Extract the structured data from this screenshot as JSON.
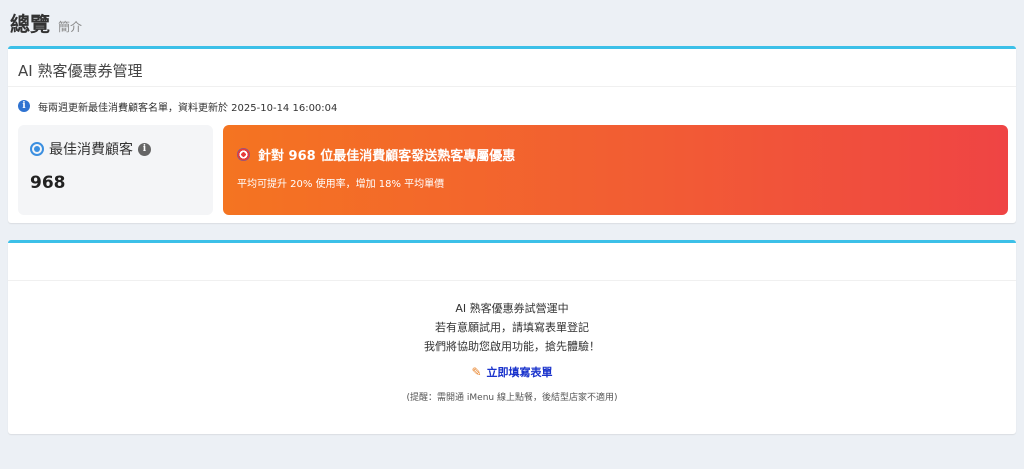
{
  "header": {
    "title": "總覽",
    "subtitle": "簡介"
  },
  "coupon_panel": {
    "title": "AI 熟客優惠券管理",
    "info_text": "每兩週更新最佳消費顧客名單，資料更新於 2025-10-14 16:00:04",
    "stat": {
      "label": "最佳消費顧客",
      "value": "968"
    },
    "promo": {
      "title": "針對 968 位最佳消費顧客發送熟客專屬優惠",
      "subtitle": "平均可提升 20% 使用率，增加 18% 平均單價"
    }
  },
  "trial_panel": {
    "lines": [
      "AI 熟客優惠券試營運中",
      "若有意願試用，請填寫表單登記",
      "我們將協助您啟用功能，搶先體驗！"
    ],
    "link_label": "立即填寫表單",
    "notice": "(提醒：需開通 iMenu 線上點餐，後結型店家不適用)"
  },
  "colors": {
    "accent_border": "#3cc0e8",
    "promo_start": "#f47421",
    "promo_end": "#ef4444",
    "link": "#1a33cc"
  },
  "icons": {
    "info": "info-icon",
    "target": "target-icon",
    "help": "help-icon",
    "dart": "dart-icon",
    "pencil": "pencil-icon"
  }
}
